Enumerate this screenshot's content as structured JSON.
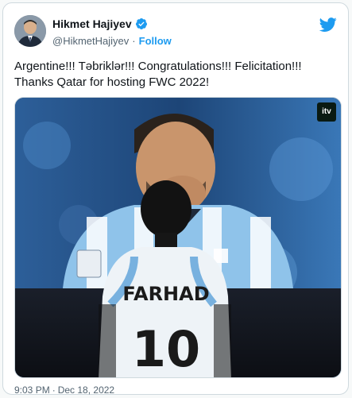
{
  "tweet": {
    "display_name": "Hikmet Hajiyev",
    "handle": "@HikmetHajiyev",
    "separator": "·",
    "follow_label": "Follow",
    "verified": true,
    "text_line_1": "Argentine!!! Təbriklər!!! Congratulations!!! Felicitation!!!",
    "text_line_2": "Thanks Qatar for hosting FWC 2022!",
    "time": "9:03 PM",
    "date": "Dec 18, 2022",
    "timestamp_separator": "·"
  },
  "media": {
    "channel_badge": "itv",
    "jersey_name": "FARHAD",
    "jersey_number": "10"
  },
  "colors": {
    "accent": "#1d9bf0",
    "text_primary": "#0f1419",
    "text_secondary": "#536471"
  },
  "icons": {
    "verified": "verified-badge-icon",
    "logo": "twitter-bird-icon"
  }
}
